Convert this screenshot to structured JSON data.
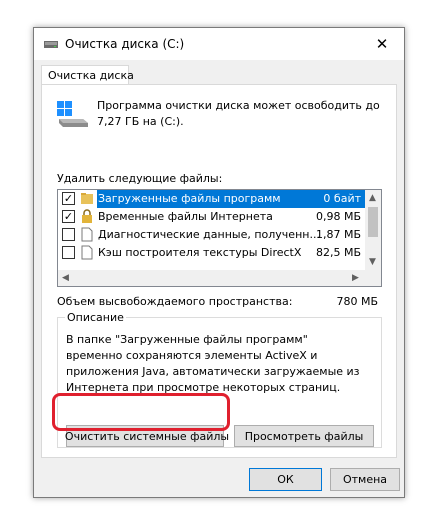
{
  "window": {
    "title": "Очистка диска  (C:)",
    "close_symbol": "✕"
  },
  "tab": {
    "label": "Очистка диска"
  },
  "intro_text": "Программа очистки диска может освободить до 7,27 ГБ на  (C:).",
  "list_label": "Удалить следующие файлы:",
  "files": [
    {
      "name": "Загруженные файлы программ",
      "size": "0 байт",
      "checked": true,
      "selected": true,
      "icon": "folder-icon"
    },
    {
      "name": "Временные файлы Интернета",
      "size": "0,98 МБ",
      "checked": true,
      "selected": false,
      "icon": "lock-icon"
    },
    {
      "name": "Диагностические данные, полученн...",
      "size": "1,87 МБ",
      "checked": false,
      "selected": false,
      "icon": "file-icon"
    },
    {
      "name": "Кэш построителя текстуры DirectX",
      "size": "82,5 МБ",
      "checked": false,
      "selected": false,
      "icon": "file-icon"
    }
  ],
  "space": {
    "label": "Объем высвобождаемого пространства:",
    "value": "780 МБ"
  },
  "description": {
    "legend": "Описание",
    "text": "В папке \"Загруженные файлы программ\" временно сохраняются элементы ActiveX и приложения Java, автоматически загружаемые из Интернета при просмотре некоторых страниц."
  },
  "buttons": {
    "clean_system": "Очистить системные файлы",
    "view_files": "Просмотреть файлы",
    "ok": "ОК",
    "cancel": "Отмена"
  },
  "colors": {
    "selection": "#0078d7",
    "highlight": "#e0202e"
  }
}
